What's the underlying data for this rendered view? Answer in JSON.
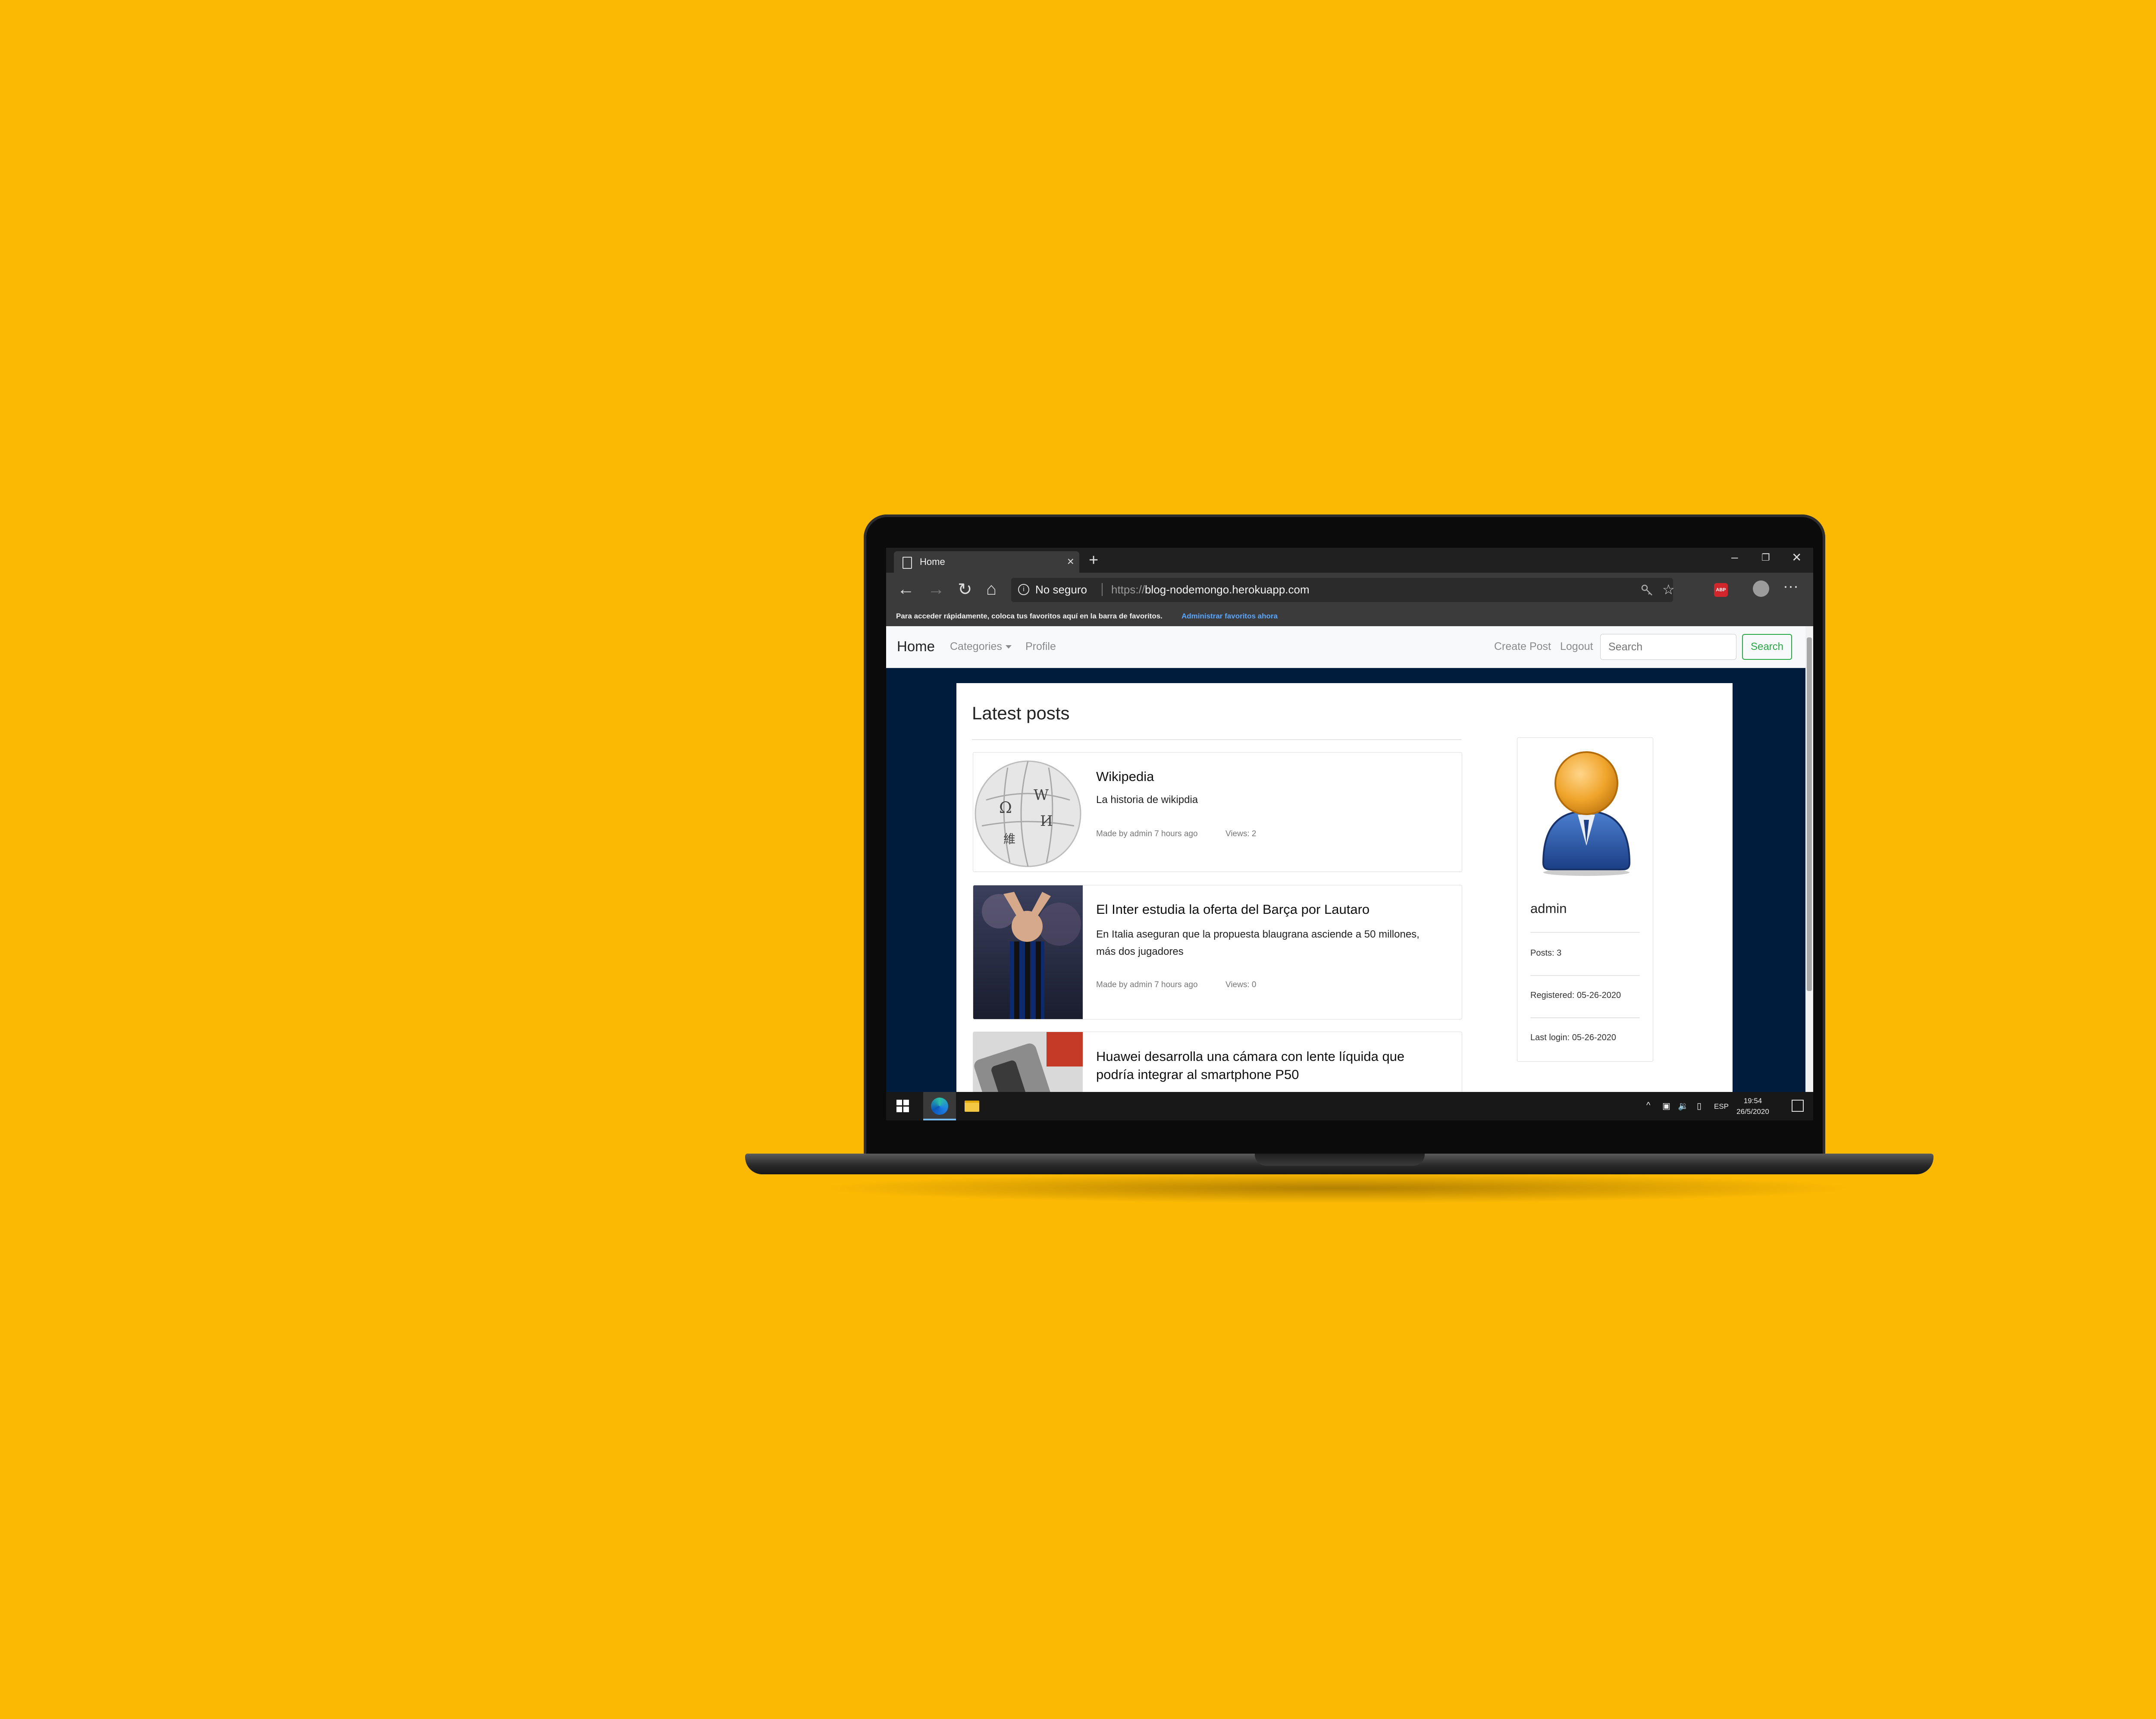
{
  "browser": {
    "tab_title": "Home",
    "new_tab": "+",
    "tab_close": "×",
    "window_controls": {
      "minimize": "–",
      "maximize": "❐",
      "close": "✕"
    },
    "nav": {
      "back": "←",
      "forward": "→",
      "refresh": "↻",
      "home": "⌂"
    },
    "security_label": "No seguro",
    "url_protocol": "https://",
    "url_host": "blog-nodemongo.herokuapp.com",
    "favorites_prompt": "Para acceder rápidamente, coloca tus favoritos aquí en la barra de favoritos.",
    "favorites_link": "Administrar favoritos ahora",
    "adblock_label": "ABP",
    "more_label": "···",
    "icons": [
      "page-icon",
      "info-icon",
      "key-icon",
      "star-icon",
      "adblock-icon",
      "profile-icon",
      "more-icon"
    ]
  },
  "navbar": {
    "brand": "Home",
    "categories": "Categories",
    "profile": "Profile",
    "create_post": "Create Post",
    "logout": "Logout",
    "search_placeholder": "Search",
    "search_button": "Search"
  },
  "main": {
    "heading": "Latest posts",
    "posts": [
      {
        "title": "Wikipedia",
        "description": "La historia de wikipdia",
        "meta": "Made by admin 7 hours ago",
        "views": "Views: 2",
        "image": "wikipedia-globe"
      },
      {
        "title": "El Inter estudia la oferta del Barça por Lautaro",
        "description": "En Italia aseguran que la propuesta blaugrana asciende a 50 millones, más dos jugadores",
        "meta": "Made by admin 7 hours ago",
        "views": "Views: 0",
        "image": "football-player"
      },
      {
        "title": "Huawei desarrolla una cámara con lente líquida que podría integrar al smartphone P50",
        "image": "smartphone"
      }
    ]
  },
  "profile_card": {
    "name": "admin",
    "posts": "Posts: 3",
    "registered": "Registered: 05-26-2020",
    "last_login": "Last login: 05-26-2020"
  },
  "taskbar": {
    "language": "ESP",
    "time": "19:54",
    "date": "26/5/2020",
    "tray_arrow": "^",
    "icons": [
      "windows-icon",
      "edge-icon",
      "file-explorer-icon",
      "network-icon",
      "volume-icon",
      "notification-icon"
    ]
  },
  "colors": {
    "background": "#fbb903",
    "page_background": "#001c3d",
    "search_button": "#28a745",
    "browser_chrome": "#3b3b3b"
  }
}
